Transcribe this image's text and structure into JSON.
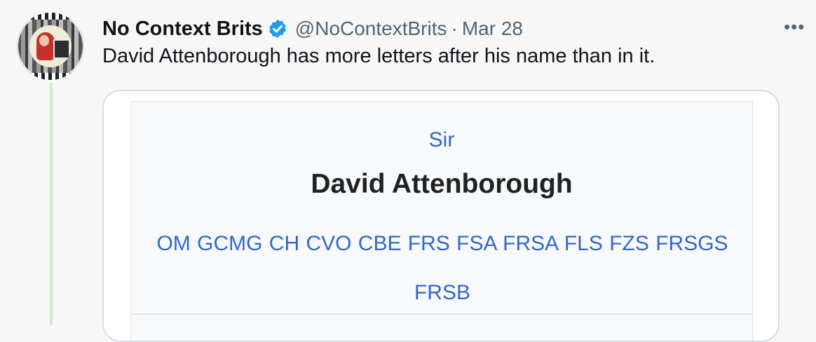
{
  "tweet": {
    "display_name": "No Context Brits",
    "handle": "@NoContextBrits",
    "separator": "·",
    "date": "Mar 28",
    "more_label": "•••",
    "text": "David Attenborough has more letters after his name than in it."
  },
  "embed": {
    "honorific_prefix": "Sir",
    "name": "David Attenborough",
    "post_nominals": "OM GCMG CH CVO CBE FRS FSA FRSA FLS FZS FRSGS FRSB"
  },
  "icons": {
    "verified": "verified-badge-icon",
    "more": "more-options-icon"
  },
  "colors": {
    "verified_blue": "#1d9bf0",
    "link_blue": "#3366cc",
    "thread_line": "#d3e8cf",
    "muted_text": "#536471"
  }
}
